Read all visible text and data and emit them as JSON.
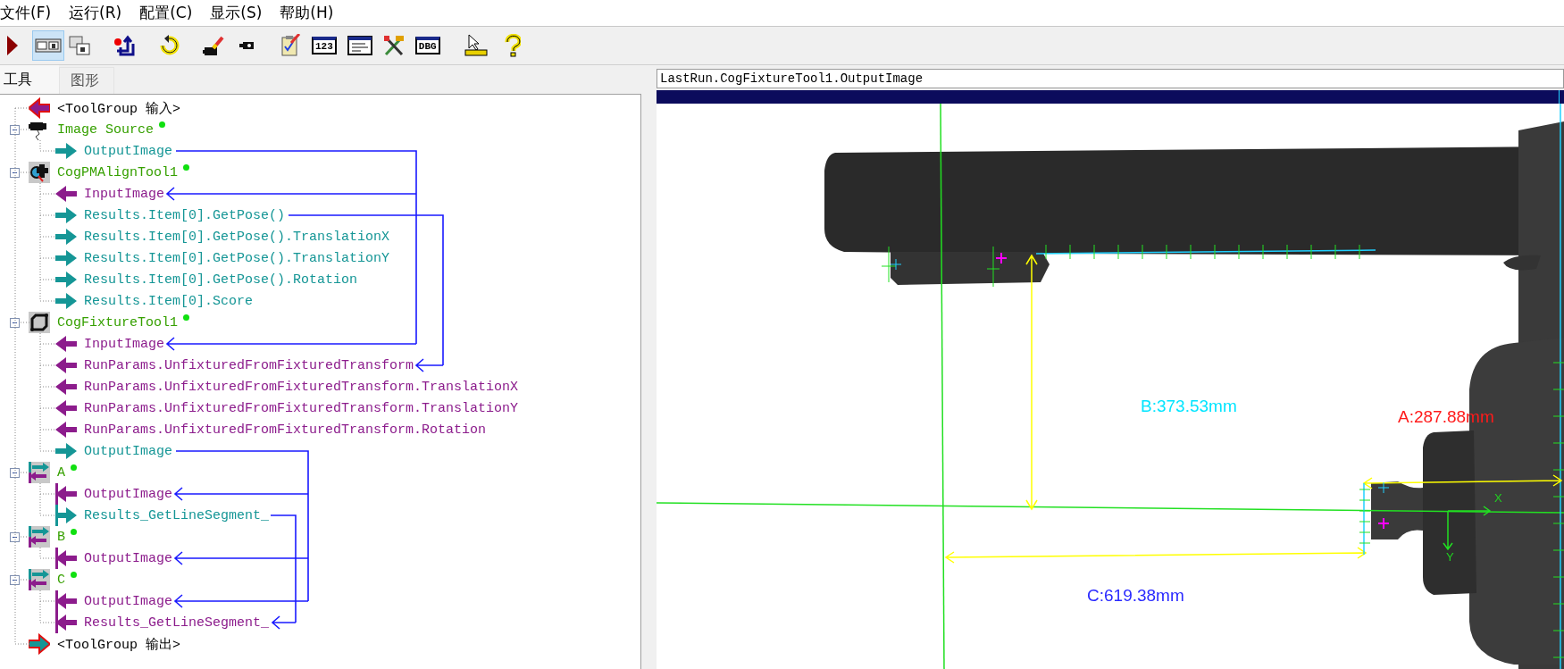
{
  "menu": [
    "文件(F)",
    "运行(R)",
    "配置(C)",
    "显示(S)",
    "帮助(H)"
  ],
  "toolbar": [
    {
      "selected": false
    },
    {
      "selected": true
    },
    {
      "selected": false
    },
    {
      "selected": false
    },
    {
      "selected": false
    },
    {
      "selected": false
    },
    {
      "selected": false
    },
    {
      "selected": false
    },
    {
      "label": "123",
      "selected": false
    },
    {
      "selected": false
    },
    {
      "selected": false
    },
    {
      "label": "DBG",
      "selected": false
    },
    {
      "selected": false
    },
    {
      "selected": false
    }
  ],
  "tabs": [
    {
      "label": "工具",
      "selected": true
    },
    {
      "label": "图形",
      "selected": false
    }
  ],
  "tree": [
    {
      "kind": "group-in",
      "label": "<ToolGroup 输入>"
    },
    {
      "kind": "acquire",
      "label": "Image Source",
      "expanded": true,
      "children": [
        {
          "kind": "output",
          "label": "OutputImage"
        }
      ]
    },
    {
      "kind": "pattern",
      "label": "CogPMAlignTool1",
      "expanded": true,
      "children": [
        {
          "kind": "input",
          "label": "InputImage"
        },
        {
          "kind": "output",
          "label": "Results.Item[0].GetPose()"
        },
        {
          "kind": "output",
          "label": "Results.Item[0].GetPose().TranslationX"
        },
        {
          "kind": "output",
          "label": "Results.Item[0].GetPose().TranslationY"
        },
        {
          "kind": "output",
          "label": "Results.Item[0].GetPose().Rotation"
        },
        {
          "kind": "output",
          "label": "Results.Item[0].Score"
        }
      ]
    },
    {
      "kind": "fixture",
      "label": "CogFixtureTool1",
      "expanded": true,
      "children": [
        {
          "kind": "input",
          "label": "InputImage"
        },
        {
          "kind": "input",
          "label": "RunParams.UnfixturedFromFixturedTransform"
        },
        {
          "kind": "input",
          "label": "RunParams.UnfixturedFromFixturedTransform.TranslationX"
        },
        {
          "kind": "input",
          "label": "RunParams.UnfixturedFromFixturedTransform.TranslationY"
        },
        {
          "kind": "input",
          "label": "RunParams.UnfixturedFromFixturedTransform.Rotation"
        },
        {
          "kind": "output",
          "label": "OutputImage"
        }
      ]
    },
    {
      "kind": "script",
      "label": "A",
      "expanded": true,
      "children": [
        {
          "kind": "input",
          "label": "OutputImage"
        },
        {
          "kind": "output",
          "label": "Results_GetLineSegment_"
        }
      ]
    },
    {
      "kind": "script",
      "label": "B",
      "expanded": true,
      "children": [
        {
          "kind": "input",
          "label": "OutputImage"
        }
      ]
    },
    {
      "kind": "script",
      "label": "C",
      "expanded": true,
      "children": [
        {
          "kind": "input",
          "label": "OutputImage"
        },
        {
          "kind": "input",
          "label": "Results_GetLineSegment_"
        }
      ]
    },
    {
      "kind": "group-out",
      "label": "<ToolGroup 输出>"
    }
  ],
  "display": {
    "source": "LastRun.CogFixtureTool1.OutputImage",
    "measurements": [
      {
        "text": "B:373.53mm",
        "color": "#00e5ff"
      },
      {
        "text": "A:287.88mm",
        "color": "#ff1a1a"
      },
      {
        "text": "C:619.38mm",
        "color": "#2a2aff"
      }
    ],
    "axis_labels": [
      "X",
      "Y"
    ]
  }
}
